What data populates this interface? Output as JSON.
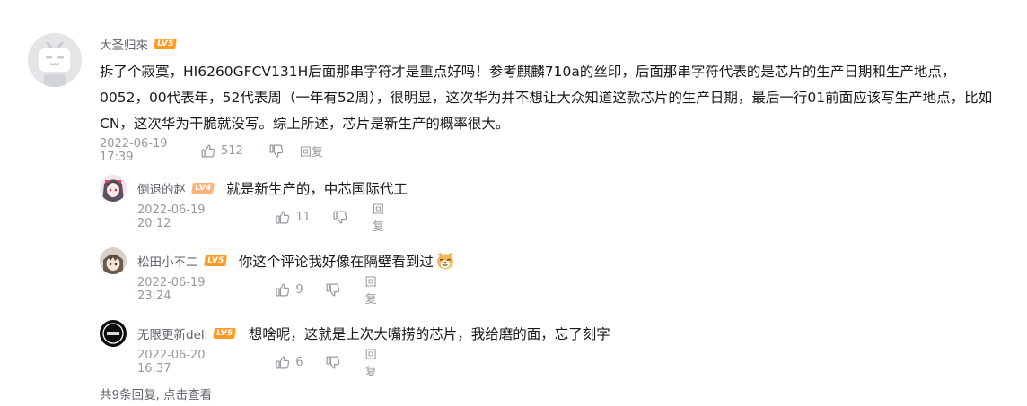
{
  "comment": {
    "username": "大圣归來",
    "level": "LV5",
    "text": "拆了个寂寞，HI6260GFCV131H后面那串字符才是重点好吗！参考麒麟710a的丝印，后面那串字符代表的是芯片的生产日期和生产地点，0052，00代表年，52代表周（一年有52周），很明显，这次华为并不想让大众知道这款芯片的生产日期，最后一行01前面应该写生产地点，比如CN，这次华为干脆就没写。综上所述，芯片是新生产的概率很大。",
    "time": "2022-06-19 17:39",
    "likes": "512",
    "reply_label": "回复"
  },
  "replies": [
    {
      "username": "倒退的赵",
      "level": "LV4",
      "text": "就是新生产的，中芯国际代工",
      "time": "2022-06-19 20:12",
      "likes": "11",
      "reply_label": "回复"
    },
    {
      "username": "松田小不二",
      "level": "LV5",
      "text": "你这个评论我好像在隔壁看到过",
      "emoji": "dog-emoji",
      "time": "2022-06-19 23:24",
      "likes": "9",
      "reply_label": "回复"
    },
    {
      "username": "无限更新dell",
      "level": "LV5",
      "text": "想啥呢，这就是上次大嘴捞的芯片，我给磨的面，忘了刻字",
      "time": "2022-06-20 16:37",
      "likes": "6",
      "reply_label": "回复"
    }
  ],
  "more_replies": "共9条回复, 点击查看",
  "colors": {
    "level_badge": "#ff9a25",
    "meta_text": "#9499a0",
    "username": "#61666d"
  }
}
